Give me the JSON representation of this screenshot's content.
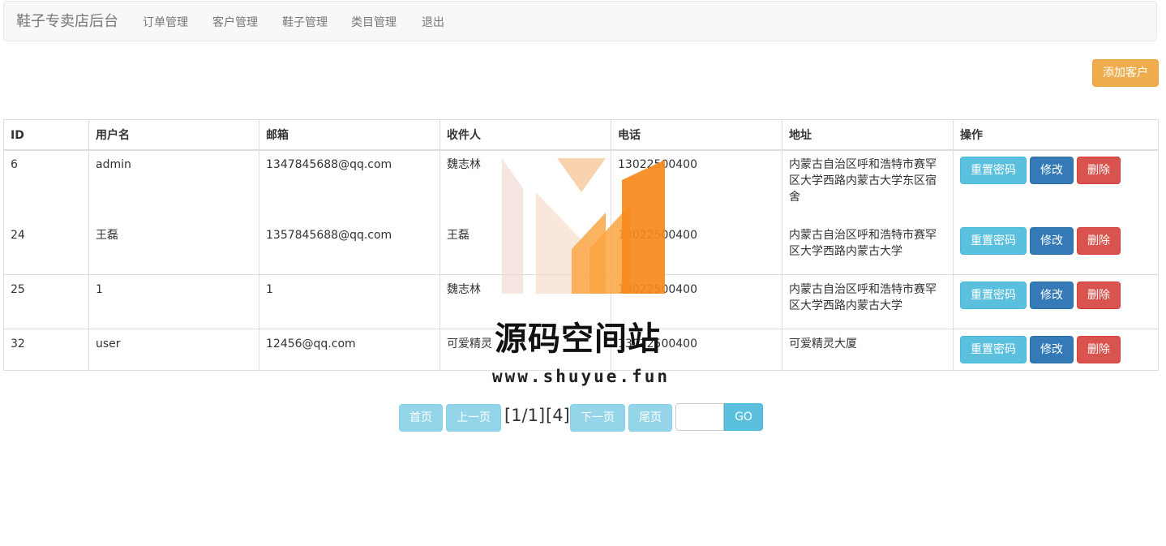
{
  "navbar": {
    "brand": "鞋子专卖店后台",
    "links": [
      "订单管理",
      "客户管理",
      "鞋子管理",
      "类目管理",
      "退出"
    ]
  },
  "toolbar": {
    "add_customer_label": "添加客户"
  },
  "table": {
    "headers": [
      "ID",
      "用户名",
      "邮箱",
      "收件人",
      "电话",
      "地址",
      "操作"
    ],
    "rows": [
      {
        "id": "6",
        "username": "admin",
        "email": "1347845688@qq.com",
        "recipient": "魏志林",
        "phone": "13022500400",
        "address": "内蒙古自治区呼和浩特市赛罕区大学西路内蒙古大学东区宿舍"
      },
      {
        "id": "24",
        "username": "王磊",
        "email": "1357845688@qq.com",
        "recipient": "王磊",
        "phone": "13022500400",
        "address": "内蒙古自治区呼和浩特市赛罕区大学西路内蒙古大学"
      },
      {
        "id": "25",
        "username": "1",
        "email": "1",
        "recipient": "魏志林",
        "phone": "13022500400",
        "address": "内蒙古自治区呼和浩特市赛罕区大学西路内蒙古大学"
      },
      {
        "id": "32",
        "username": "user",
        "email": "12456@qq.com",
        "recipient": "可爱精灵",
        "phone": "13022500400",
        "address": "可爱精灵大厦"
      }
    ],
    "actions": {
      "reset_password": "重置密码",
      "edit": "修改",
      "delete": "删除"
    }
  },
  "pager": {
    "first": "首页",
    "prev": "上一页",
    "page_info": "[1/1]",
    "total": "[4]",
    "next": "下一页",
    "last": "尾页",
    "go": "GO",
    "page_input_value": ""
  },
  "watermark": {
    "title": "源码空间站",
    "url": "www.shuyue.fun"
  },
  "colors": {
    "warning": "#f0ad4e",
    "info": "#5bc0de",
    "primary": "#337ab7",
    "danger": "#d9534f"
  }
}
